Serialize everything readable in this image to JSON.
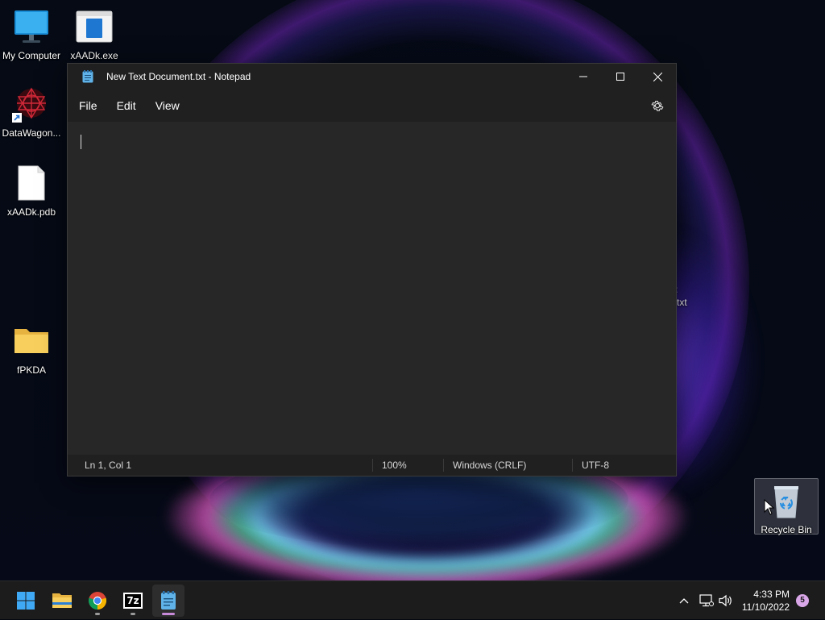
{
  "desktop": {
    "icons": {
      "my_computer": "My Computer",
      "xaadk_exe": "xAADk.exe",
      "datawagon": "DataWagon...",
      "xaadk_pdb": "xAADk.pdb",
      "fpkda": "fPKDA",
      "recycle_bin": "Recycle Bin"
    },
    "stray_text": ":",
    "stray_text2": "txt"
  },
  "notepad": {
    "title": "New Text Document.txt - Notepad",
    "menu": {
      "file": "File",
      "edit": "Edit",
      "view": "View"
    },
    "status": {
      "position": "Ln 1, Col 1",
      "zoom": "100%",
      "line_ending": "Windows (CRLF)",
      "encoding": "UTF-8"
    },
    "content": ""
  },
  "taskbar": {
    "apps": [
      "start-icon",
      "file-explorer-icon",
      "chrome-icon",
      "7zip-icon",
      "notepad-icon"
    ],
    "seven_zip_label": "7z",
    "clock": {
      "time": "4:33 PM",
      "date": "11/10/2022"
    },
    "notification_count": "5"
  },
  "colors": {
    "window_bg": "#202020",
    "editor_bg": "#272727",
    "taskbar_bg": "#1c1c1c",
    "active_indicator": "#c78ad9"
  }
}
